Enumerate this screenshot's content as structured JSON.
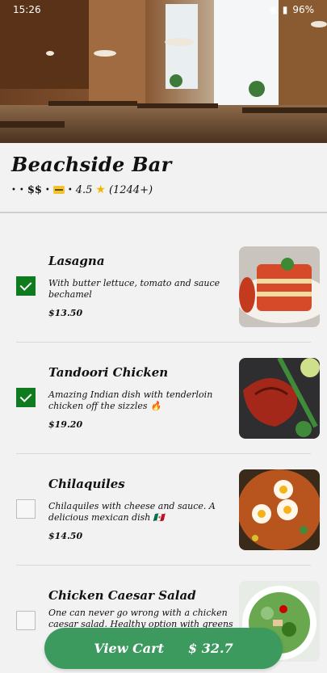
{
  "status": {
    "time": "15:26",
    "battery": "96%"
  },
  "restaurant": {
    "name": "Beachside Bar",
    "price_level": "$$",
    "rating": "4.5",
    "reviews": "(1244+)"
  },
  "menu": [
    {
      "name": "Lasagna",
      "description": "With butter lettuce, tomato and sauce bechamel",
      "price": "$13.50",
      "selected": true
    },
    {
      "name": "Tandoori Chicken",
      "description": "Amazing Indian dish with tenderloin chicken off the sizzles 🔥",
      "price": "$19.20",
      "selected": true
    },
    {
      "name": "Chilaquiles",
      "description": "Chilaquiles with cheese and sauce. A delicious mexican dish 🇲🇽",
      "price": "$14.50",
      "selected": false
    },
    {
      "name": "Chicken Caesar Salad",
      "description": "One can never go wrong with a chicken caesar salad. Healthy option with greens and",
      "price": "",
      "selected": false
    }
  ],
  "cart": {
    "label": "View Cart",
    "total": "$ 32.7"
  },
  "colors": {
    "accent": "#3d9a5f",
    "checked": "#0f7a1e"
  }
}
